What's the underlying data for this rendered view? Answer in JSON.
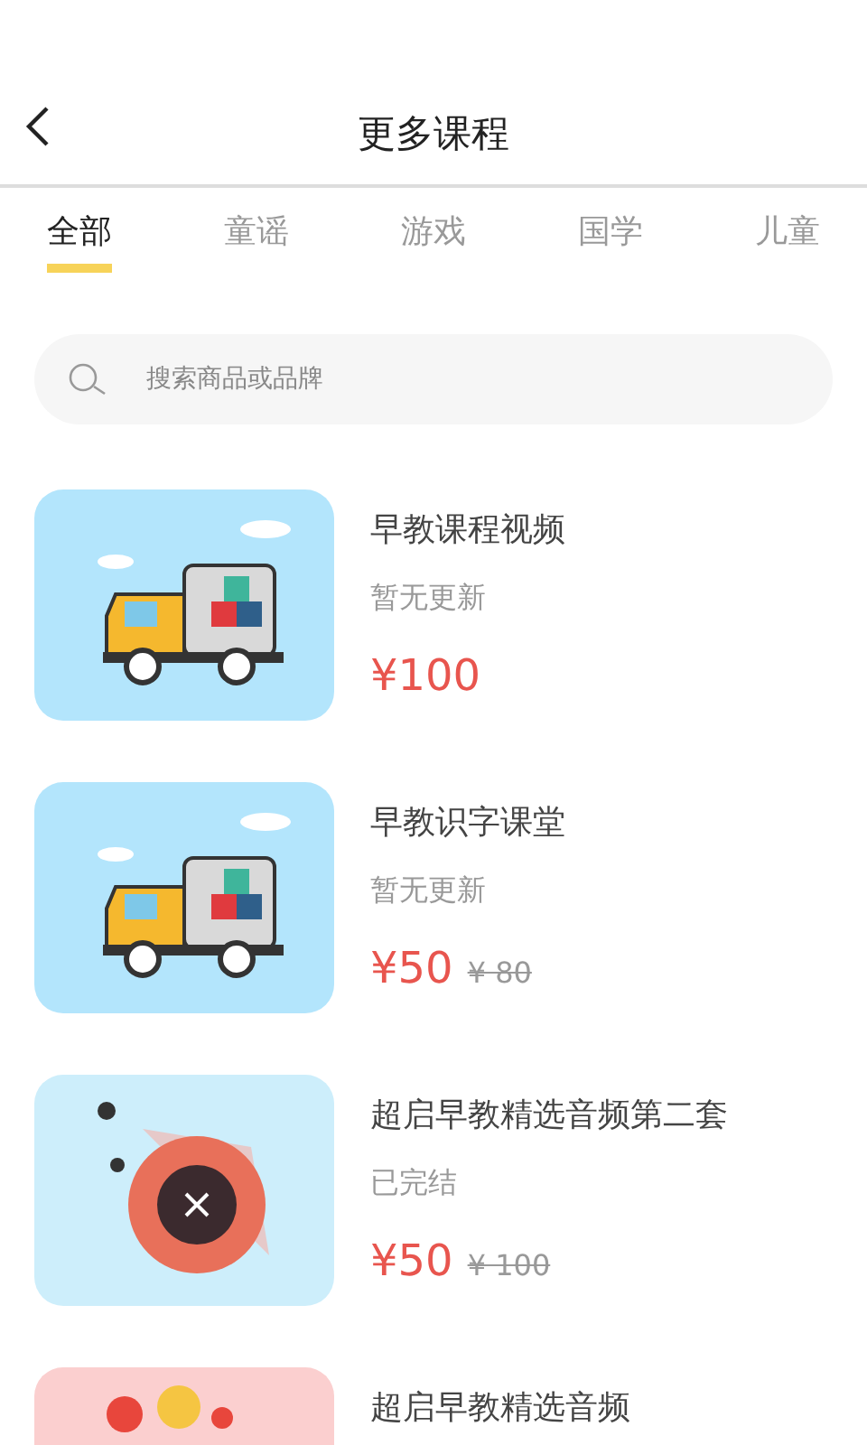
{
  "header": {
    "title": "更多课程"
  },
  "tabs": [
    {
      "label": "全部",
      "selected": true
    },
    {
      "label": "童谣",
      "selected": false
    },
    {
      "label": "游戏",
      "selected": false
    },
    {
      "label": "国学",
      "selected": false
    },
    {
      "label": "儿童",
      "selected": false
    }
  ],
  "search": {
    "placeholder": "搜索商品或品牌"
  },
  "courses": [
    {
      "title": "早教课程视频",
      "status": "暂无更新",
      "price": "¥100"
    },
    {
      "title": "早教识字课堂",
      "status": "暂无更新",
      "price": "¥50",
      "old_price": "¥ 80"
    },
    {
      "title": "超启早教精选音频第二套",
      "status": "已完结",
      "price": "¥50",
      "old_price": "¥ 100"
    },
    {
      "title": "超启早教精选音频"
    }
  ]
}
